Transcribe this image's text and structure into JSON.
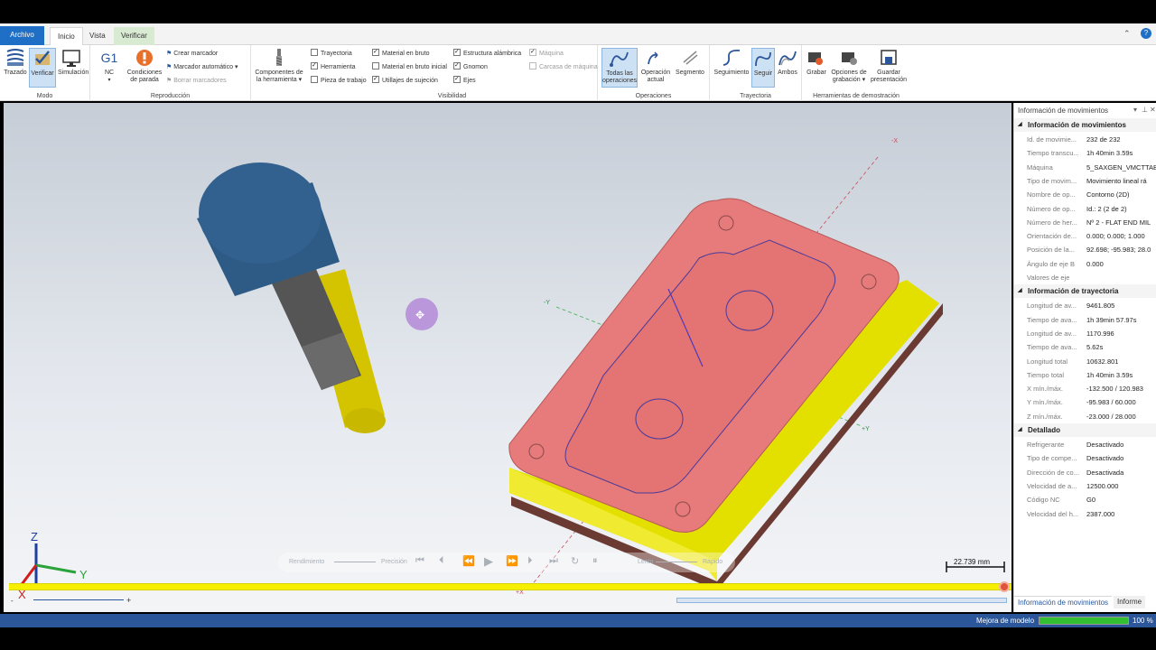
{
  "tabs": {
    "file": "Archivo",
    "home": "Inicio",
    "view": "Vista",
    "verify": "Verificar"
  },
  "ribbon": {
    "mode": {
      "label": "Modo",
      "trace": "Trazado",
      "verify": "Verificar",
      "simulation": "Simulación"
    },
    "playback": {
      "label": "Reproducción",
      "g1": "G1",
      "nc": "NC",
      "stop": "Condiciones de parada",
      "create_marker": "Crear marcador",
      "auto_marker": "Marcador automático",
      "delete_markers": "Borrar marcadores"
    },
    "tool_components": "Componentes de la herramienta",
    "visibility": {
      "label": "Visibilidad",
      "items": [
        {
          "label": "Trayectoria",
          "checked": false,
          "enabled": true
        },
        {
          "label": "Herramienta",
          "checked": true,
          "enabled": true
        },
        {
          "label": "Pieza de trabajo",
          "checked": false,
          "enabled": true
        },
        {
          "label": "Material en bruto",
          "checked": true,
          "enabled": true
        },
        {
          "label": "Material en bruto inicial",
          "checked": false,
          "enabled": true
        },
        {
          "label": "Utillajes de sujeción",
          "checked": true,
          "enabled": true
        },
        {
          "label": "Estructura alámbrica",
          "checked": true,
          "enabled": true
        },
        {
          "label": "Gnomon",
          "checked": true,
          "enabled": true
        },
        {
          "label": "Ejes",
          "checked": true,
          "enabled": true
        },
        {
          "label": "Máquina",
          "checked": true,
          "enabled": false
        },
        {
          "label": "Carcasa de máquina",
          "checked": false,
          "enabled": false
        }
      ]
    },
    "operations": {
      "label": "Operaciones",
      "all": "Todas las operaciones",
      "current": "Operación actual",
      "segment": "Segmento"
    },
    "trajectory": {
      "label": "Trayectoria",
      "tracking": "Seguimiento",
      "follow": "Seguir",
      "both": "Ambos"
    },
    "demo": {
      "label": "Herramientas de demostración",
      "record": "Grabar",
      "record_options": "Opciones de grabación",
      "save_presentation": "Guardar presentación"
    }
  },
  "viewport": {
    "axis_neg_x": "-X",
    "axis_neg_y": "-Y",
    "axis_pos_y": "+Y",
    "axis_pos_x": "+X",
    "gnomon_x": "X",
    "gnomon_y": "Y",
    "gnomon_z": "Z",
    "scale": "22.739 mm",
    "playback": {
      "performance": "Rendimiento",
      "precision": "Precisión",
      "slow": "Lento",
      "fast": "Rápido"
    },
    "colors": {
      "part_top": "#e77a7a",
      "part_side": "#e3e000",
      "fixture": "#6b3b33",
      "tool_holder": "#33618f",
      "tool_cutter": "#d4c400",
      "timeline": "#f6ef00"
    }
  },
  "panel": {
    "title": "Información de movimientos",
    "sections": [
      {
        "title": "Información de movimientos",
        "rows": [
          {
            "k": "Id. de movimie...",
            "v": "232 de 232"
          },
          {
            "k": "Tiempo transcu...",
            "v": "1h 40min 3.59s"
          },
          {
            "k": "Máquina",
            "v": "5_SAXGEN_VMCTTAB"
          },
          {
            "k": "Tipo de movim...",
            "v": "Movimiento lineal rá"
          },
          {
            "k": "Nombre de op...",
            "v": "Contorno (2D)"
          },
          {
            "k": "Número de op...",
            "v": "Id.: 2 (2 de 2)"
          },
          {
            "k": "Número de her...",
            "v": "Nº 2 - FLAT END MIL"
          },
          {
            "k": "Orientación de...",
            "v": "0.000; 0.000; 1.000"
          },
          {
            "k": "Posición de la...",
            "v": "92.698; -95.983; 28.0"
          },
          {
            "k": "Ángulo de eje B",
            "v": "0.000"
          },
          {
            "k": "Valores de eje",
            "v": ""
          }
        ]
      },
      {
        "title": "Información de trayectoria",
        "rows": [
          {
            "k": "Longitud de av...",
            "v": "9461.805"
          },
          {
            "k": "Tiempo de ava...",
            "v": "1h 39min 57.97s"
          },
          {
            "k": "Longitud de av...",
            "v": "1170.996"
          },
          {
            "k": "Tiempo de ava...",
            "v": "5.62s"
          },
          {
            "k": "Longitud total",
            "v": "10632.801"
          },
          {
            "k": "Tiempo total",
            "v": "1h 40min 3.59s"
          },
          {
            "k": "X mín./máx.",
            "v": "-132.500 / 120.983"
          },
          {
            "k": "Y mín./máx.",
            "v": "-95.983 / 60.000"
          },
          {
            "k": "Z mín./máx.",
            "v": "-23.000 / 28.000"
          }
        ]
      },
      {
        "title": "Detallado",
        "rows": [
          {
            "k": "Refrigerante",
            "v": "Desactivado"
          },
          {
            "k": "Tipo de compe...",
            "v": "Desactivado"
          },
          {
            "k": "Dirección de co...",
            "v": "Desactivada"
          },
          {
            "k": "Velocidad de a...",
            "v": "12500.000"
          },
          {
            "k": "Código NC",
            "v": "G0"
          },
          {
            "k": "Velocidad del h...",
            "v": "2387.000"
          }
        ]
      }
    ],
    "tab_info": "Información de movimientos",
    "tab_report": "Informe"
  },
  "status": {
    "text": "Mejora de modelo",
    "percent_label": "100 %",
    "progress": 1.0
  }
}
